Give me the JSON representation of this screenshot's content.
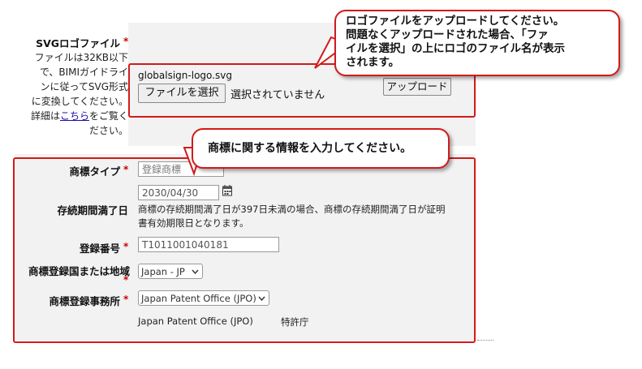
{
  "logo_section": {
    "label": "SVGロゴファイル",
    "required_mark": "*",
    "desc_lines": [
      "ファイルは32KB以下",
      "で、BIMIガイドライ",
      "ンに従ってSVG形式",
      "に変換してください。"
    ],
    "desc_prefix": "詳細は",
    "desc_link": "こちら",
    "desc_suffix": "をご覧く",
    "desc_last": "ださい。",
    "file_name": "globalsign-logo.svg",
    "choose_button": "ファイルを選択",
    "no_file_text": "選択されていません",
    "upload_button": "アップロード"
  },
  "callout_upload": {
    "lines": [
      "ロゴファイルをアップロードしてください。",
      "問題なくアップロードされた場合、「ファ",
      "イルを選択」の上にロゴのファイル名が表示",
      "されます。"
    ]
  },
  "callout_trademark": {
    "text": "商標に関する情報を入力してください。"
  },
  "trademark": {
    "type_label": "商標タイプ",
    "type_placeholder": "登録商標",
    "expiry_label": "存続期間満了日",
    "expiry_value": "2030/04/30",
    "expiry_note_1": "商標の存続期間満了日が397日未満の場合、商標の存続期間満了日が証明",
    "expiry_note_2": "書有効期限日となります。",
    "number_label": "登録番号",
    "number_value": "T1011001040181",
    "country_label": "商標登録国または地域",
    "country_value": "Japan - JP",
    "office_label": "商標登録事務所",
    "office_value": "Japan Patent Office (JPO)",
    "office_en": "Japan Patent Office (JPO)",
    "office_ja": "特許庁",
    "required_mark": "*"
  },
  "colors": {
    "accent_red": "#d21a1a",
    "panel_gray": "#f2f2f2",
    "link_blue": "#1a0dab"
  },
  "icons": {
    "calendar": "calendar-icon",
    "dropdown": "chevron-down-icon"
  }
}
